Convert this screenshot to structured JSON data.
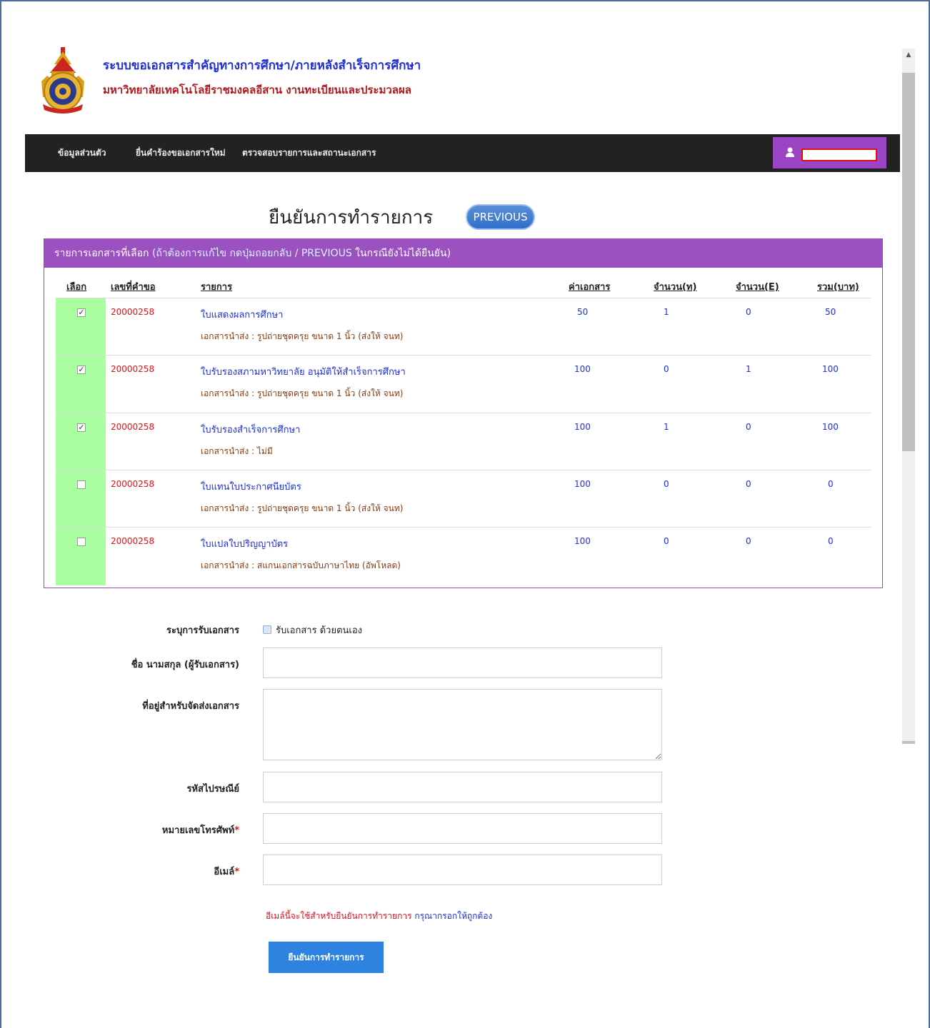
{
  "header": {
    "title": "ระบบขอเอกสารสำคัญทางการศึกษา/ภายหลังสำเร็จการศึกษา",
    "subtitle": "มหาวิทยาลัยเทคโนโลยีราชมงคลอีสาน งานทะเบียนและประมวลผล",
    "logo_icon": "university-seal-icon"
  },
  "navbar": {
    "items": [
      {
        "label": "ข้อมูลส่วนตัว"
      },
      {
        "label": "ยื่นคำร้องขอเอกสารใหม่"
      },
      {
        "label": "ตรวจสอบรายการและสถานะเอกสาร"
      }
    ],
    "user_icon": "user-icon",
    "user_name": ""
  },
  "page": {
    "title": "ยืนยันการทำรายการ",
    "previous_button": "PREVIOUS"
  },
  "panel": {
    "heading_main": "รายการเอกสารที่เลือก",
    "heading_hint_open": "(ถ้าต้องการแก้ไข กดปุ่มถอยกลับ / ",
    "heading_hint_previous": "PREVIOUS",
    "heading_hint_close": " ในกรณียังไม่ได้ยืนยัน)",
    "columns": {
      "select": "เลือก",
      "request_no": "เลขที่คำขอ",
      "item": "รายการ",
      "fee": "ค่าเอกสาร",
      "qty_th": "จำนวน(ท)",
      "qty_en": "จำนวน(E)",
      "total": "รวม(บาท)"
    },
    "rows": [
      {
        "checked": true,
        "mark": "✓",
        "request_no": "20000258",
        "name": "ใบแสดงผลการศึกษา",
        "attachment": "เอกสารนำส่ง : รูปถ่ายชุดครุย ขนาด 1 นิ้ว (ส่งให้ จนท)",
        "fee": "50",
        "qty_th": "1",
        "qty_en": "0",
        "total": "50"
      },
      {
        "checked": true,
        "mark": "✓",
        "request_no": "20000258",
        "name": "ใบรับรองสภามหาวิทยาลัย อนุมัติให้สำเร็จการศึกษา",
        "attachment": "เอกสารนำส่ง : รูปถ่ายชุดครุย ขนาด 1 นิ้ว (ส่งให้ จนท)",
        "fee": "100",
        "qty_th": "0",
        "qty_en": "1",
        "total": "100"
      },
      {
        "checked": true,
        "mark": "✓",
        "request_no": "20000258",
        "name": "ใบรับรองสำเร็จการศึกษา",
        "attachment": "เอกสารนำส่ง : ไม่มี",
        "fee": "100",
        "qty_th": "1",
        "qty_en": "0",
        "total": "100"
      },
      {
        "checked": false,
        "mark": "",
        "request_no": "20000258",
        "name": "ใบแทนใบประกาศนียบัตร",
        "attachment": "เอกสารนำส่ง : รูปถ่ายชุดครุย ขนาด 1 นิ้ว (ส่งให้ จนท)",
        "fee": "100",
        "qty_th": "0",
        "qty_en": "0",
        "total": "0"
      },
      {
        "checked": false,
        "mark": "",
        "request_no": "20000258",
        "name": "ใบแปลใบปริญญาบัตร",
        "attachment": "เอกสารนำส่ง : สแกนเอกสารฉบับภาษาไทย (อัพโหลด)",
        "fee": "100",
        "qty_th": "0",
        "qty_en": "0",
        "total": "0"
      }
    ]
  },
  "form": {
    "pickup_label": "ระบุการรับเอกสาร",
    "pickup_option": "รับเอกสาร ด้วยตนเอง",
    "name_label": "ชื่อ นามสกุล (ผู้รับเอกสาร)",
    "name_value": "",
    "address_label": "ที่อยู่สำหรับจัดส่งเอกสาร",
    "address_value": "",
    "postcode_label": "รหัสไปรษณีย์",
    "postcode_value": "",
    "phone_label": "หมายเลขโทรศัพท์",
    "phone_value": "",
    "email_label": "อีเมล์",
    "email_value": "",
    "required_mark": "*",
    "note_red": "อีเมล์นี้จะใช้สำหรับยืนยันการทำรายการ",
    "note_blue": " กรุณากรอกให้ถูกต้อง",
    "submit_button": "ยืนยันการทำรายการ"
  },
  "scrollbar": {
    "up_arrow": "▲"
  },
  "colors": {
    "navbar_bg": "#222222",
    "accent_purple": "#9b52c0",
    "select_col_green": "#a9ff9f",
    "title_blue": "#1f2fd8",
    "subtitle_red": "#b3181e",
    "submit_blue": "#2f83e0"
  }
}
